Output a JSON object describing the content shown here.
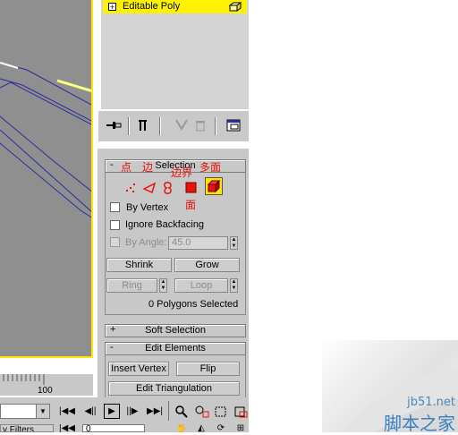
{
  "modifier_stack": {
    "item_label": "Editable Poly",
    "expand_sign": "+"
  },
  "stack_toolbar": {
    "icons": [
      "pin-stack-icon",
      "show-end-result-icon",
      "make-unique-icon",
      "remove-modifier-icon",
      "configure-sets-icon"
    ]
  },
  "selection_rollout": {
    "sign": "-",
    "title": "Selection",
    "subobject_modes": [
      "vertex",
      "edge",
      "border",
      "polygon",
      "element"
    ],
    "by_vertex": "By Vertex",
    "ignore_backfacing": "Ignore Backfacing",
    "by_angle": "By Angle:",
    "angle_value": "45.0",
    "shrink": "Shrink",
    "grow": "Grow",
    "ring": "Ring",
    "loop": "Loop",
    "status": "0 Polygons Selected"
  },
  "annotations": {
    "point": "点",
    "edge": "边",
    "border": "边界",
    "polygon": "多面",
    "face": "面"
  },
  "soft_selection": {
    "sign": "+",
    "title": "Soft Selection"
  },
  "edit_elements": {
    "sign": "-",
    "title": "Edit Elements",
    "insert_vertex": "Insert Vertex",
    "flip": "Flip",
    "edit_triangulation": "Edit Triangulation"
  },
  "timeline": {
    "tick_label": "100"
  },
  "bottom": {
    "frame_value": "0",
    "filters_label": "y Filters"
  },
  "watermark": {
    "site": "jb51.net",
    "name": "脚本之家"
  },
  "colors": {
    "stack_highlight": "#fff200",
    "viewport_border": "#ffe700",
    "annotation_red": "#e8140c",
    "wireframe": "#2a2aa0"
  }
}
